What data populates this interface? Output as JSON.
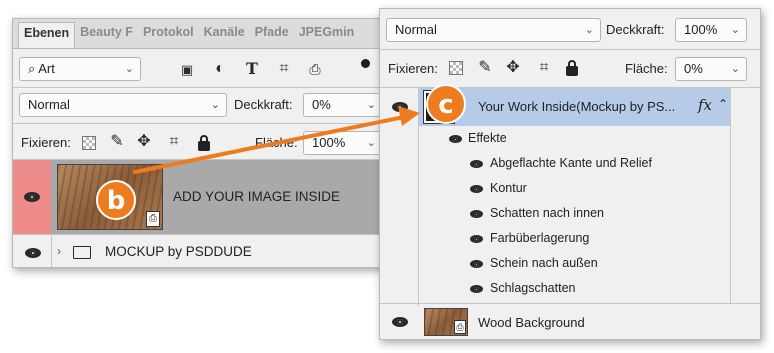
{
  "left_panel": {
    "tabs": [
      "Ebenen",
      "Beauty F",
      "Protokol",
      "Kanäle",
      "Pfade",
      "JPEGmin"
    ],
    "filter_kind": "Art",
    "blend_mode": "Normal",
    "opacity_label": "Deckkraft:",
    "opacity_value": "0%",
    "lock_label": "Fixieren:",
    "fill_label": "Fläche:",
    "fill_value": "100%",
    "layers": [
      {
        "name": "ADD YOUR IMAGE INSIDE"
      },
      {
        "name": "MOCKUP by PSDDUDE"
      }
    ]
  },
  "right_panel": {
    "blend_mode": "Normal",
    "opacity_label": "Deckkraft:",
    "opacity_value": "100%",
    "lock_label": "Fixieren:",
    "fill_label": "Fläche:",
    "fill_value": "0%",
    "selected_layer": "Your Work Inside(Mockup by PS...",
    "fx_symbol": "fx",
    "effects_header": "Effekte",
    "effects": [
      "Abgeflachte Kante und Relief",
      "Kontur",
      "Schatten nach innen",
      "Farbüberlagerung",
      "Schein nach außen",
      "Schlagschatten"
    ],
    "bottom_layer": "Wood Background"
  },
  "callouts": {
    "b": "b",
    "c": "c",
    "accent_color": "#ee7c1e",
    "selection_color": "#b5cbe8",
    "highlight_color": "#f08a8a"
  }
}
